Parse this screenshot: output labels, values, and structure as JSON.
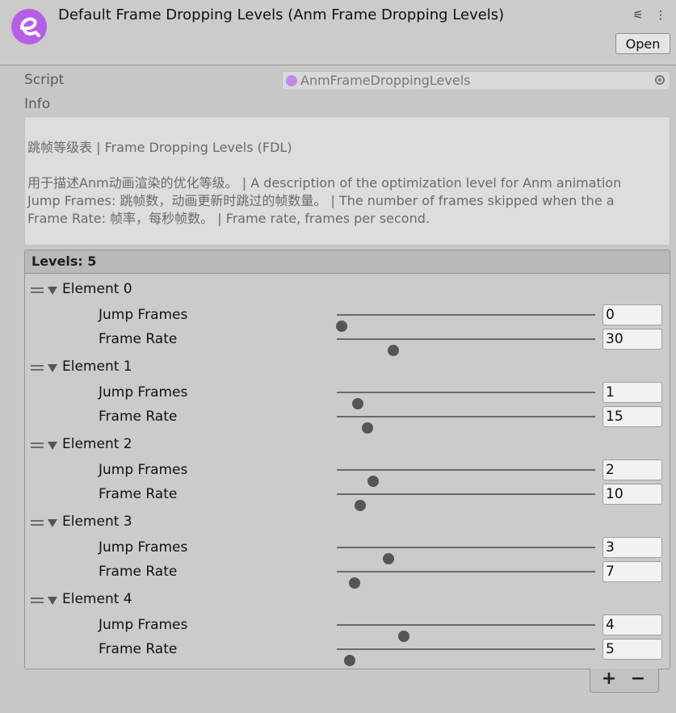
{
  "header": {
    "title": "Default Frame Dropping Levels (Anm Frame Dropping Levels)",
    "open_label": "Open",
    "icons": [
      "settings-sliders-icon",
      "more-options-icon"
    ]
  },
  "script": {
    "label": "Script",
    "value": "AnmFrameDroppingLevels"
  },
  "info": {
    "label": "Info",
    "lines": [
      "跳帧等级表 | Frame Dropping Levels (FDL)",
      "用于描述Anm动画渲染的优化等级。 | A description of the optimization level for Anm animation",
      "Jump Frames: 跳帧数，动画更新时跳过的帧数量。 | The number of frames skipped when the a",
      "Frame Rate: 帧率，每秒帧数。 | Frame rate, frames per second."
    ]
  },
  "levels": {
    "header": "Levels: 5",
    "elements": [
      {
        "label": "Element 0",
        "jump_label": "Jump Frames",
        "jump_value": "0",
        "jump_fraction": 0.02,
        "rate_label": "Frame Rate",
        "rate_value": "30",
        "rate_fraction": 0.22
      },
      {
        "label": "Element 1",
        "jump_label": "Jump Frames",
        "jump_value": "1",
        "jump_fraction": 0.08,
        "rate_label": "Frame Rate",
        "rate_value": "15",
        "rate_fraction": 0.12
      },
      {
        "label": "Element 2",
        "jump_label": "Jump Frames",
        "jump_value": "2",
        "jump_fraction": 0.14,
        "rate_label": "Frame Rate",
        "rate_value": "10",
        "rate_fraction": 0.09
      },
      {
        "label": "Element 3",
        "jump_label": "Jump Frames",
        "jump_value": "3",
        "jump_fraction": 0.2,
        "rate_label": "Frame Rate",
        "rate_value": "7",
        "rate_fraction": 0.07
      },
      {
        "label": "Element 4",
        "jump_label": "Jump Frames",
        "jump_value": "4",
        "jump_fraction": 0.26,
        "rate_label": "Frame Rate",
        "rate_value": "5",
        "rate_fraction": 0.05
      }
    ],
    "add_label": "+",
    "remove_label": "−"
  },
  "colors": {
    "accent": "#b55ee6",
    "background": "#c8c8c8"
  }
}
